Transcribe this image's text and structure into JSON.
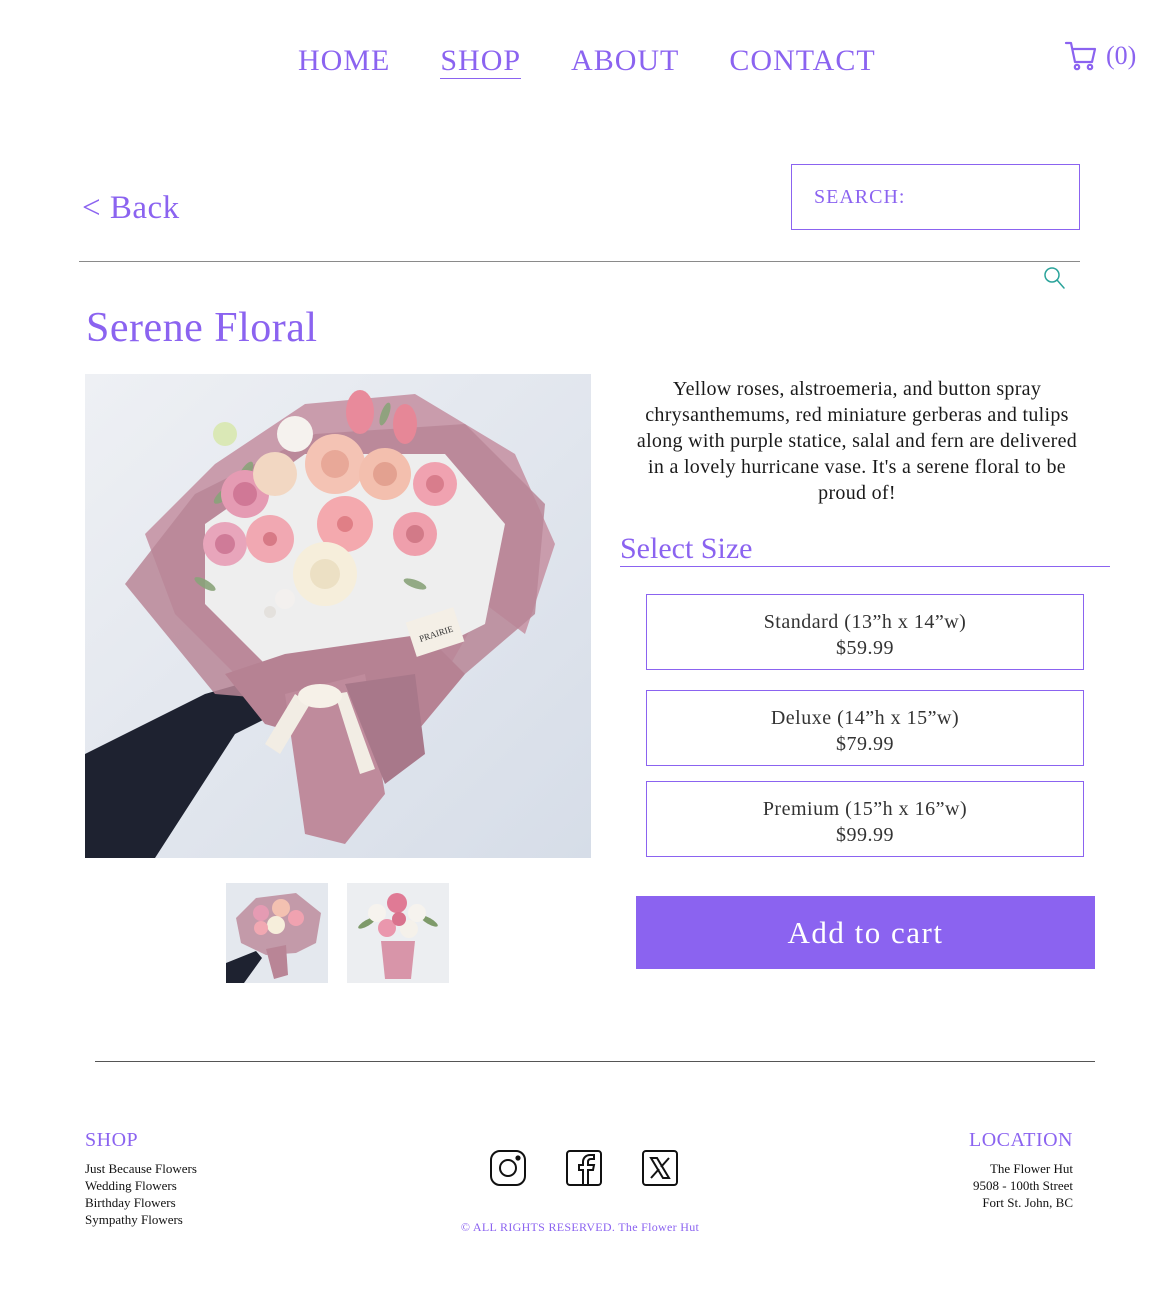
{
  "nav": {
    "items": [
      {
        "label": "HOME",
        "active": false
      },
      {
        "label": "SHOP",
        "active": true
      },
      {
        "label": "ABOUT",
        "active": false
      },
      {
        "label": "CONTACT",
        "active": false
      }
    ],
    "cart_count": "(0)",
    "cart_icon": "shopping-cart-icon"
  },
  "back_label": "< Back",
  "search": {
    "placeholder": "SEARCH:",
    "icon": "search-icon"
  },
  "product": {
    "title": "Serene Floral",
    "description": "Yellow roses, alstroemeria, and button spray chrysanthemums, red miniature gerberas and tulips along with purple statice, salal and fern are delivered in a lovely hurricane vase. It's a serene floral to be proud of!",
    "select_size_label": "Select Size",
    "sizes": [
      {
        "name": "Standard (13”h x 14”w)",
        "price": "$59.99"
      },
      {
        "name": "Deluxe (14”h x 15”w)",
        "price": "$79.99"
      },
      {
        "name": "Premium (15”h x 16”w)",
        "price": "$99.99"
      }
    ],
    "add_to_cart_label": "Add to cart",
    "wrapper_tag": "PRAIRIE"
  },
  "footer": {
    "shop_heading": "SHOP",
    "shop_links": [
      "Just Because Flowers",
      "Wedding Flowers",
      "Birthday Flowers",
      "Sympathy Flowers"
    ],
    "location_heading": "LOCATION",
    "location_lines": [
      "The Flower Hut",
      "9508 - 100th Street",
      "Fort St. John, BC"
    ],
    "socials": [
      "instagram-icon",
      "facebook-icon",
      "x-icon"
    ],
    "copyright": "© ALL RIGHTS RESERVED. The Flower Hut"
  },
  "colors": {
    "accent": "#8b63f0",
    "rule": "#8a8a8a"
  }
}
